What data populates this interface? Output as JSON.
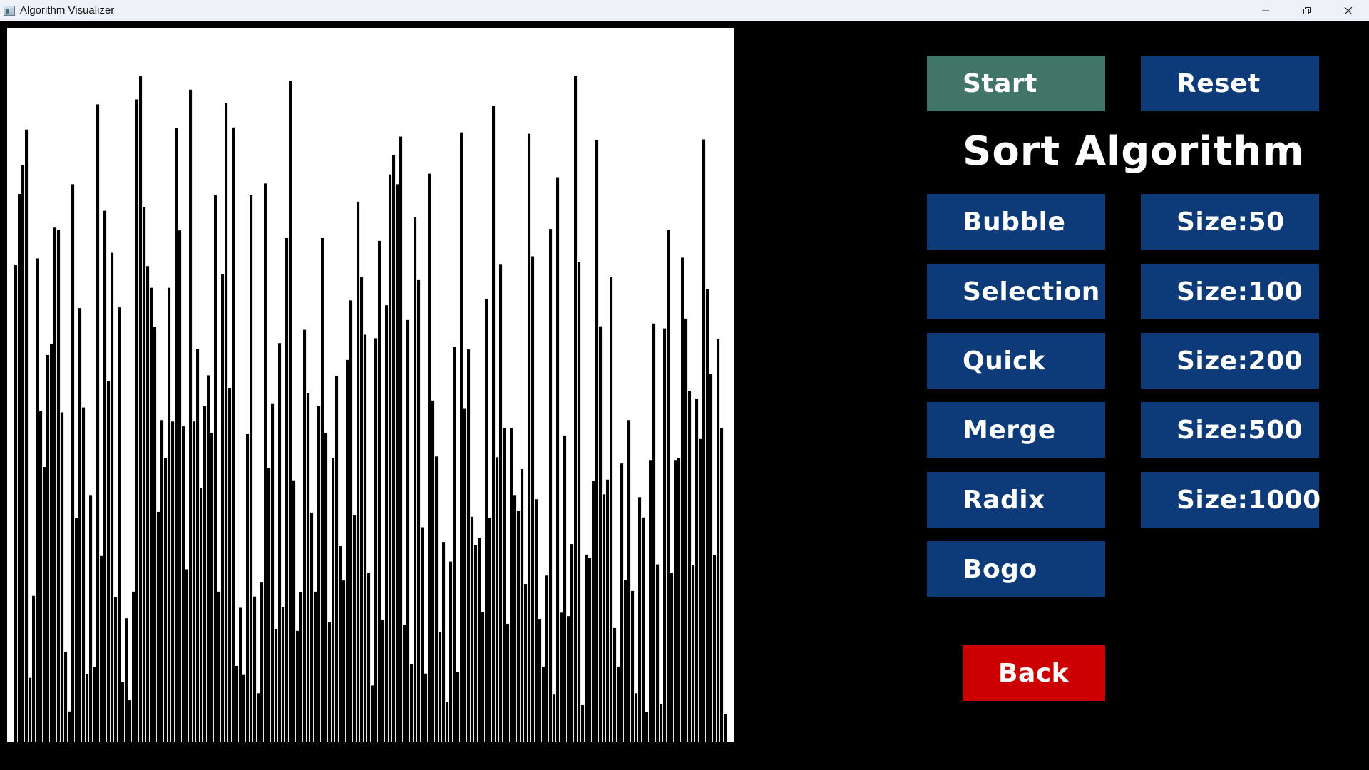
{
  "window": {
    "title": "Algorithm Visualizer",
    "icon": "app-window-icon",
    "controls": [
      "minimize-icon",
      "restore-icon",
      "close-icon"
    ]
  },
  "controls": {
    "start_label": "Start",
    "reset_label": "Reset",
    "back_label": "Back"
  },
  "section_title": "Sort Algorithm",
  "algorithms": [
    "Bubble",
    "Selection",
    "Quick",
    "Merge",
    "Radix",
    "Bogo"
  ],
  "sizes": [
    "Size:50",
    "Size:100",
    "Size:200",
    "Size:500",
    "Size:1000"
  ],
  "colors": {
    "background": "#000000",
    "button": "#0d3a78",
    "start_button": "#417568",
    "back_button": "#cc0000",
    "bar": "#000000",
    "canvas": "#ffffff"
  },
  "visualizer": {
    "bar_count": 200,
    "max_value": 1000
  }
}
